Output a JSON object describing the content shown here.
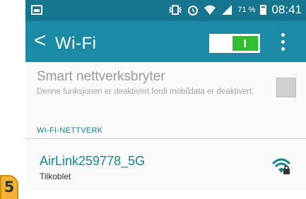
{
  "statusbar": {
    "battery_percent": "71 %",
    "time": "08:41",
    "icons": [
      "image-icon",
      "vibrate-icon",
      "alarm-icon",
      "wifi-icon",
      "signal-icon",
      "battery-icon"
    ]
  },
  "header": {
    "back_glyph": "<",
    "title": "Wi-Fi",
    "wifi_toggle_on": true
  },
  "smart_switch": {
    "title": "Smart nettverksbryter",
    "description": "Denne funksjonen er deaktivert fordi mobildata er deaktivert.",
    "checked": false
  },
  "section": {
    "label": "WI-FI-NETTVERK"
  },
  "networks": [
    {
      "name": "AirLink259778_5G",
      "status": "Tilkoblet",
      "secured": true
    }
  ],
  "badge": {
    "number": "5"
  },
  "colors": {
    "statusbar": "#17768f",
    "actionbar": "#1a8aa6",
    "accent": "#17868f",
    "toggle_on": "#2fbf2f",
    "badge": "#f5b335"
  }
}
